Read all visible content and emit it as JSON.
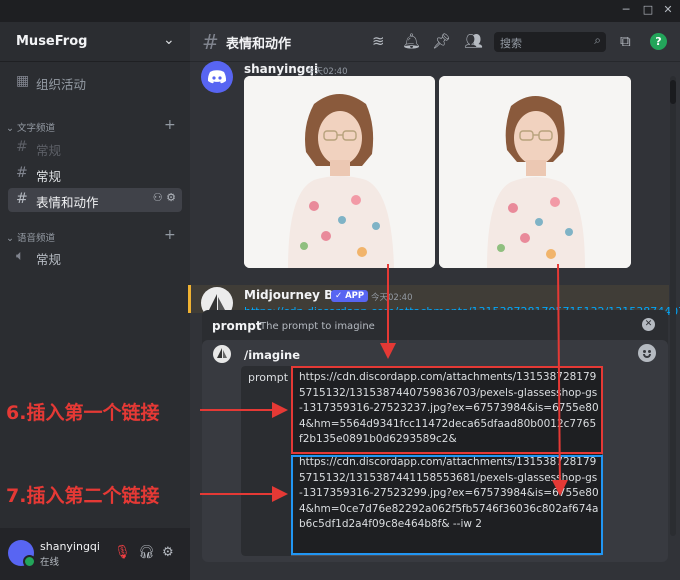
{
  "window": {
    "minimize": "─",
    "maximize": "□",
    "close": "✕"
  },
  "server": {
    "name": "MuseFrog",
    "chevron": "⌄"
  },
  "sidebar": {
    "activity": {
      "label": "组织活动",
      "icon": "calendar-icon"
    },
    "text_category": "文字频道",
    "text_channels": [
      {
        "label": "常规",
        "muted": true
      },
      {
        "label": "常规",
        "muted": false
      },
      {
        "label": "表情和动作",
        "active": true
      }
    ],
    "voice_category": "语音频道",
    "voice_channels": [
      {
        "label": "常规"
      }
    ],
    "add_glyph": "+"
  },
  "user": {
    "name": "shanyingqi",
    "status": "在线"
  },
  "header": {
    "channel": "表情和动作",
    "search_placeholder": "搜索",
    "help": "?"
  },
  "messages": [
    {
      "author": "shanyingqi",
      "time": "今天02:40"
    },
    {
      "author": "Midjourney Bot",
      "badge": "✓ APP",
      "time": "今天02:40",
      "link_preview": "https://cdn.discordapp.com/attachments/1315387281795715132/1315387440759836703/pexels-glassesshop-gs-"
    }
  ],
  "command_popup": {
    "name": "prompt",
    "description": "The prompt to imagine",
    "close": "✕"
  },
  "composer": {
    "command": "/imagine",
    "param_label": "prompt",
    "url1": "https://cdn.discordapp.com/attachments/1315387281795715132/1315387440759836703/pexels-glassesshop-gs-1317359316-27523237.jpg?ex=67573984&is=6755e804&hm=5564d9341fcc11472deca65dfaad80b0012c7765f2b135e0891b0d6293589c2&",
    "url2": "https://cdn.discordapp.com/attachments/1315387281795715132/1315387441158553681/pexels-glassesshop-gs-1317359316-27523299.jpg?ex=67573984&is=6755e804&hm=0ce7d76e82292a062f5fb5746f36036c802af674ab6c5df1d2a4f09c8e464b8f& --iw 2"
  },
  "annotations": {
    "step6": "6.插入第一个链接",
    "step7": "7.插入第二个链接"
  },
  "colors": {
    "accent": "#5865f2",
    "annotation_red": "#e53935",
    "highlight_blue": "#2196f3",
    "online": "#23a55a"
  }
}
